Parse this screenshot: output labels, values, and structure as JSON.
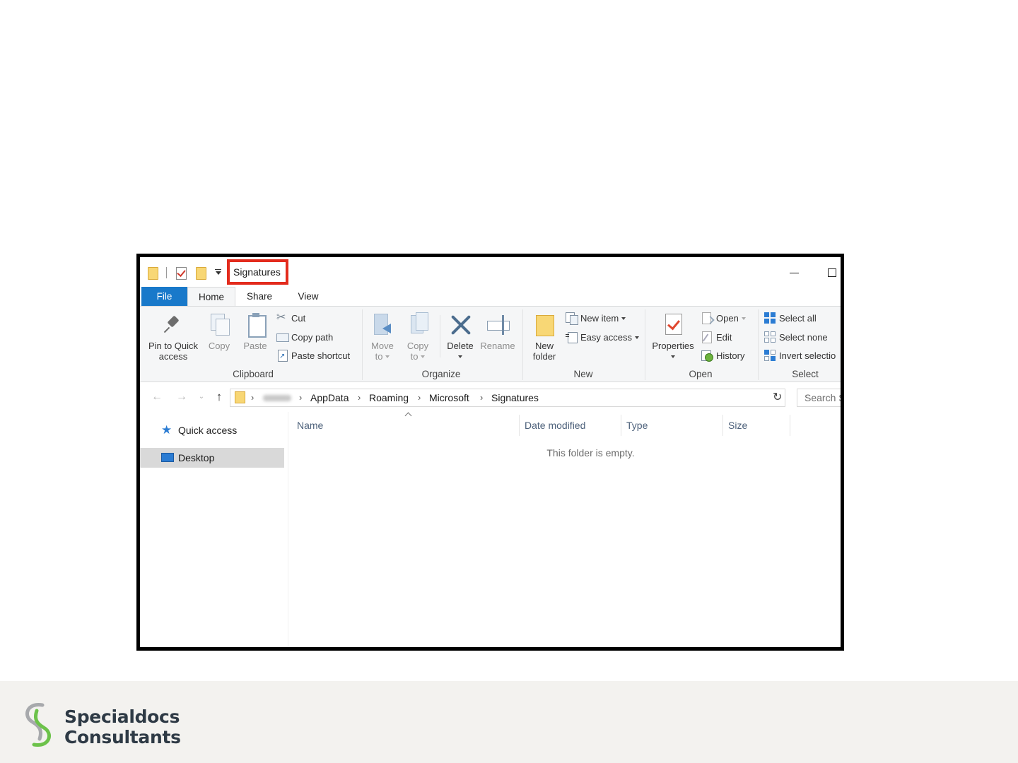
{
  "window": {
    "title": "Signatures",
    "tabs": [
      "File",
      "Home",
      "Share",
      "View"
    ]
  },
  "ribbon": {
    "clipboard": {
      "label": "Clipboard",
      "pin_label_1": "Pin to Quick",
      "pin_label_2": "access",
      "copy": "Copy",
      "paste": "Paste",
      "cut": "Cut",
      "copy_path": "Copy path",
      "paste_shortcut": "Paste shortcut"
    },
    "organize": {
      "label": "Organize",
      "move_to_1": "Move",
      "move_to_2": "to",
      "copy_to_1": "Copy",
      "copy_to_2": "to",
      "delete": "Delete",
      "rename": "Rename"
    },
    "new": {
      "label": "New",
      "new_folder_1": "New",
      "new_folder_2": "folder",
      "new_item": "New item",
      "easy_access": "Easy access"
    },
    "open": {
      "label": "Open",
      "properties": "Properties",
      "open": "Open",
      "edit": "Edit",
      "history": "History"
    },
    "select": {
      "label": "Select",
      "select_all": "Select all",
      "select_none": "Select none",
      "invert_selection": "Invert selectio"
    }
  },
  "address_bar": {
    "crumbs": [
      "AppData",
      "Roaming",
      "Microsoft",
      "Signatures"
    ],
    "search_placeholder": "Search S"
  },
  "nav_pane": {
    "items": [
      {
        "label": "Quick access",
        "icon": "star-icon"
      },
      {
        "label": "Desktop",
        "icon": "desktop-icon",
        "selected": true
      }
    ]
  },
  "content": {
    "columns": [
      "Name",
      "Date modified",
      "Type",
      "Size"
    ],
    "empty_message": "This folder is empty."
  },
  "footer": {
    "brand_line_1": "Specialdocs",
    "brand_line_2": "Consultants"
  },
  "colors": {
    "highlight_box": "#e32b1d",
    "file_tab": "#1979ca",
    "brand_text": "#2e3a45",
    "logo_green": "#6cc24a",
    "logo_gray": "#a7a9ac"
  }
}
